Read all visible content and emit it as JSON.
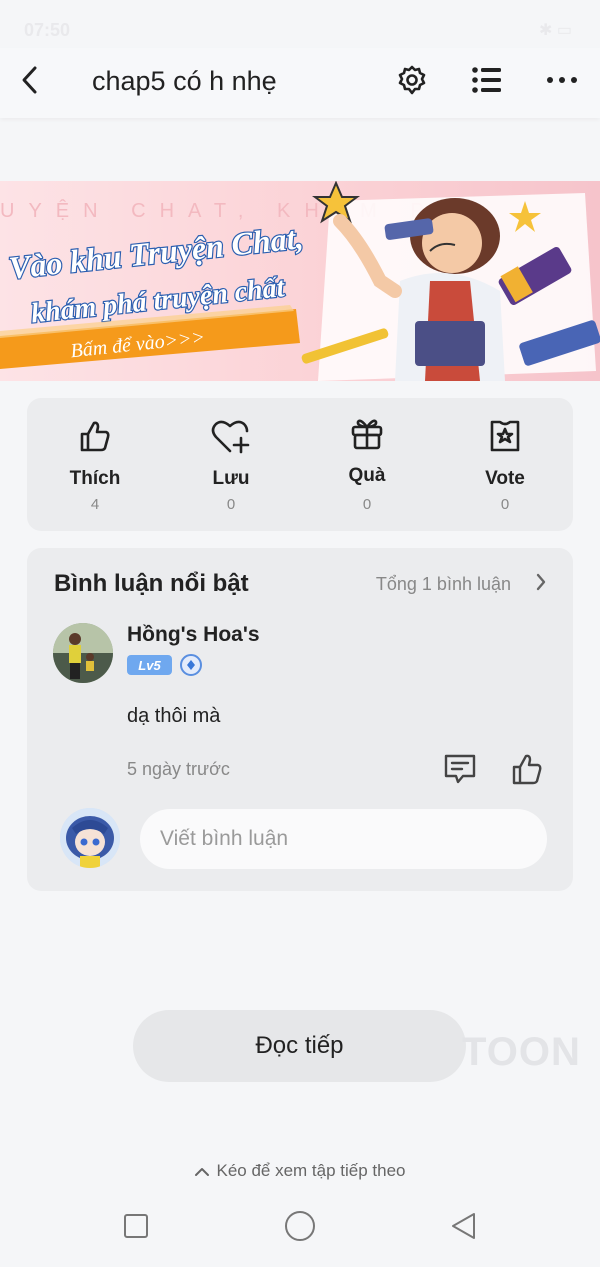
{
  "status_bar": {
    "time": "07:50",
    "right": "✱ ▭"
  },
  "header": {
    "title": "chap5 có h nhẹ"
  },
  "banner": {
    "headline1": "Vào khu Truyện Chat,",
    "headline2": "khám phá truyện chất",
    "cta": "Bấm để vào>>>",
    "bg_text": "UYỆN CHAT, KHÁM PHÁ"
  },
  "actions": [
    {
      "label": "Thích",
      "count": "4"
    },
    {
      "label": "Lưu",
      "count": "0"
    },
    {
      "label": "Quà",
      "count": "0"
    },
    {
      "label": "Vote",
      "count": "0"
    }
  ],
  "comments": {
    "title": "Bình luận nổi bật",
    "total": "Tổng 1 bình luận",
    "items": [
      {
        "user": "Hồng's Hoa's",
        "level": "Lv5",
        "text": "dạ thôi mà",
        "time": "5 ngày trước"
      }
    ],
    "input_placeholder": "Viết bình luận"
  },
  "read_next": "Đọc tiếp",
  "watermark": "TOON",
  "pull_hint": "Kéo để xem tập tiếp theo",
  "colors": {
    "accent_orange": "#f59a1b",
    "level_badge": "#6fa8ef",
    "card_bg": "#ebecee"
  }
}
